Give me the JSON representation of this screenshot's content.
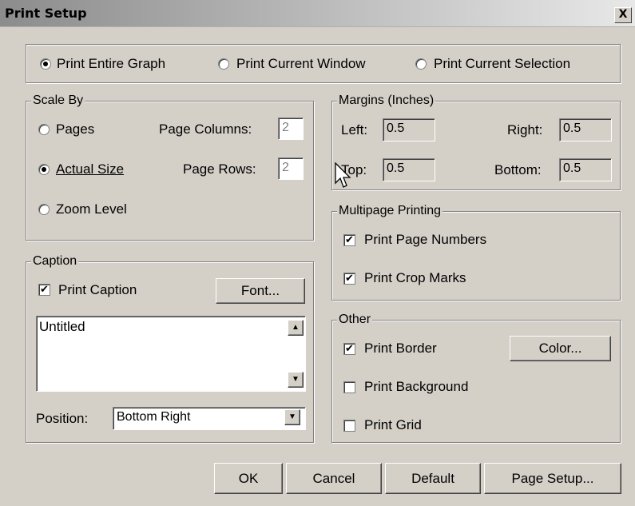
{
  "window": {
    "title": "Print Setup",
    "close_glyph": "X"
  },
  "print_scope": {
    "options": [
      {
        "label": "Print Entire Graph",
        "selected": true
      },
      {
        "label": "Print Current Window",
        "selected": false
      },
      {
        "label": "Print Current Selection",
        "selected": false
      }
    ]
  },
  "scale_by": {
    "legend": "Scale By",
    "options": [
      {
        "label": "Pages",
        "selected": false
      },
      {
        "label": "Actual Size",
        "selected": true
      },
      {
        "label": "Zoom Level",
        "selected": false
      }
    ],
    "page_columns_label": "Page Columns:",
    "page_columns_value": "2",
    "page_rows_label": "Page Rows:",
    "page_rows_value": "2"
  },
  "margins": {
    "legend": "Margins (Inches)",
    "left_label": "Left:",
    "left_value": "0.5",
    "right_label": "Right:",
    "right_value": "0.5",
    "top_label": "Top:",
    "top_value": "0.5",
    "bottom_label": "Bottom:",
    "bottom_value": "0.5"
  },
  "multipage": {
    "legend": "Multipage Printing",
    "items": [
      {
        "label": "Print Page Numbers",
        "checked": true
      },
      {
        "label": "Print Crop Marks",
        "checked": true
      }
    ]
  },
  "caption": {
    "legend": "Caption",
    "print_caption_label": "Print Caption",
    "print_caption_checked": true,
    "font_button": "Font...",
    "text": "Untitled",
    "position_label": "Position:",
    "position_value": "Bottom Right"
  },
  "other": {
    "legend": "Other",
    "items": [
      {
        "label": "Print Border",
        "checked": true
      },
      {
        "label": "Print Background",
        "checked": false
      },
      {
        "label": "Print Grid",
        "checked": false
      }
    ],
    "color_button": "Color..."
  },
  "buttons": {
    "ok": "OK",
    "cancel": "Cancel",
    "default": "Default",
    "page_setup": "Page Setup..."
  },
  "glyphs": {
    "check": "✔",
    "up": "▲",
    "down": "▼"
  },
  "colors": {
    "dialog_bg": "#d4d0c8",
    "title_gradient_start": "#8c8c8c",
    "title_gradient_end": "#e8e8e8"
  }
}
